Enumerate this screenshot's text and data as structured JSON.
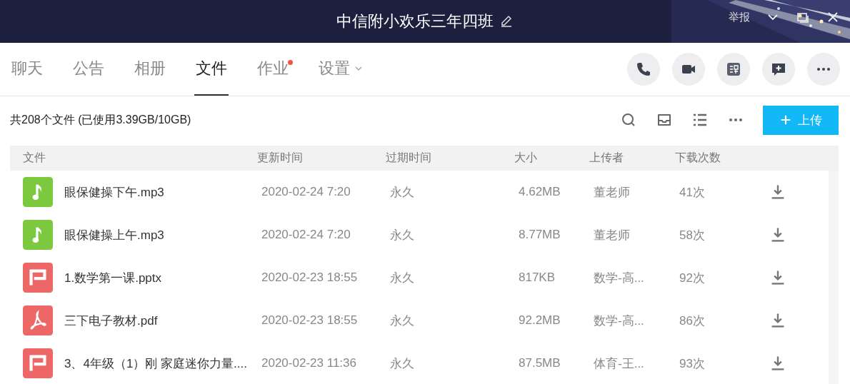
{
  "window": {
    "title": "中信附小欢乐三年四班",
    "report": "举报"
  },
  "tabs": [
    {
      "label": "聊天",
      "selected": false,
      "notification": false,
      "dropdown": false
    },
    {
      "label": "公告",
      "selected": false,
      "notification": false,
      "dropdown": false
    },
    {
      "label": "相册",
      "selected": false,
      "notification": false,
      "dropdown": false
    },
    {
      "label": "文件",
      "selected": true,
      "notification": false,
      "dropdown": false
    },
    {
      "label": "作业",
      "selected": false,
      "notification": true,
      "dropdown": false
    },
    {
      "label": "设置",
      "selected": false,
      "notification": false,
      "dropdown": true
    }
  ],
  "summary": "共208个文件 (已使用3.39GB/10GB)",
  "upload_button": {
    "label": "上传"
  },
  "table": {
    "columns": [
      "文件",
      "更新时间",
      "过期时间",
      "大小",
      "上传者",
      "下载次数"
    ],
    "rows": [
      {
        "kind": "audio",
        "name": "眼保健操下午.mp3",
        "updated": "2020-02-24 7:20",
        "expires": "永久",
        "size": "4.62MB",
        "uploader": "董老师",
        "downloads": "41次"
      },
      {
        "kind": "audio",
        "name": "眼保健操上午.mp3",
        "updated": "2020-02-24 7:20",
        "expires": "永久",
        "size": "8.77MB",
        "uploader": "董老师",
        "downloads": "58次"
      },
      {
        "kind": "ppt",
        "name": "1.数学第一课.pptx",
        "updated": "2020-02-23 18:55",
        "expires": "永久",
        "size": "817KB",
        "uploader": "数学-高...",
        "downloads": "92次"
      },
      {
        "kind": "pdf",
        "name": "三下电子教材.pdf",
        "updated": "2020-02-23 18:55",
        "expires": "永久",
        "size": "92.2MB",
        "uploader": "数学-高...",
        "downloads": "86次"
      },
      {
        "kind": "ppt",
        "name": "3、4年级（1）刚 家庭迷你力量....",
        "updated": "2020-02-23 11:36",
        "expires": "永久",
        "size": "87.5MB",
        "uploader": "体育-王...",
        "downloads": "93次"
      }
    ]
  }
}
